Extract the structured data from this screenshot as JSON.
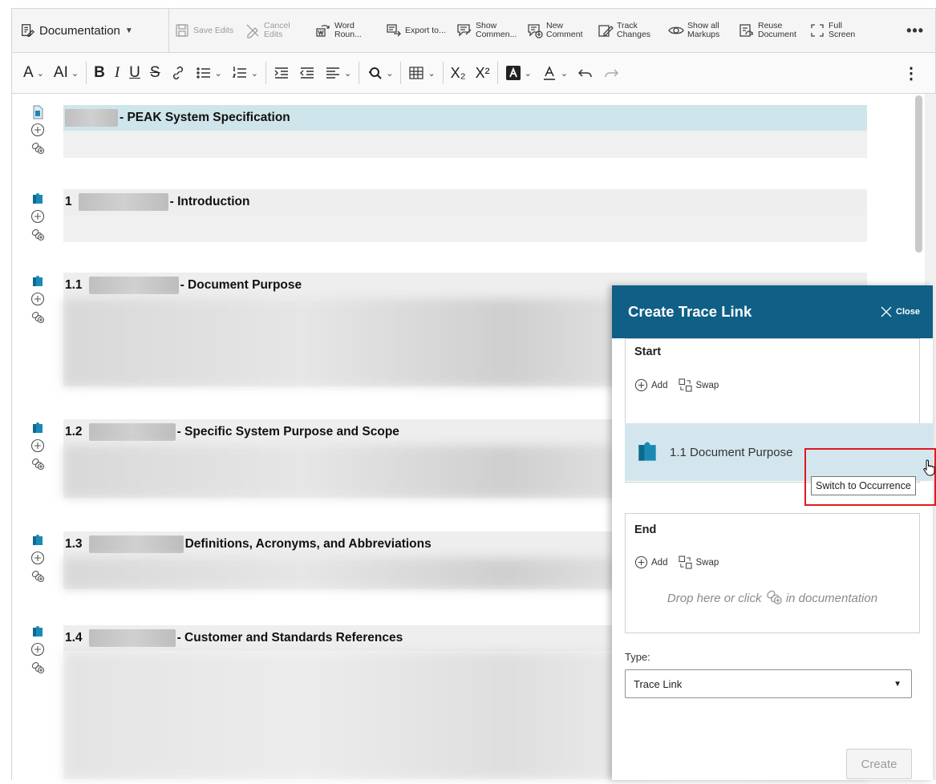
{
  "toolbar": {
    "documentation_label": "Documentation",
    "buttons": [
      {
        "label": "Save Edits",
        "icon": "save-icon",
        "disabled": true
      },
      {
        "label": "Cancel Edits",
        "icon": "cancel-edits-icon",
        "disabled": true
      },
      {
        "label": "Word Roun...",
        "icon": "word-roundtrip-icon",
        "disabled": false
      },
      {
        "label": "Export to...",
        "icon": "export-icon",
        "disabled": false
      },
      {
        "label": "Show Commen...",
        "icon": "show-comments-icon",
        "disabled": false
      },
      {
        "label": "New Comment",
        "icon": "new-comment-icon",
        "disabled": false
      },
      {
        "label": "Track Changes",
        "icon": "track-changes-icon",
        "disabled": false
      },
      {
        "label": "Show all Markups",
        "icon": "show-markups-icon",
        "disabled": false
      },
      {
        "label": "Reuse Document",
        "icon": "reuse-document-icon",
        "disabled": false
      },
      {
        "label": "Full Screen",
        "icon": "full-screen-icon",
        "disabled": false
      }
    ],
    "more_label": "•••"
  },
  "format_toolbar": {
    "text_style": "A",
    "font_size": "AI",
    "bold": "B",
    "italic": "I",
    "underline": "U",
    "strike": "S",
    "subscript": "X₂",
    "superscript": "X²",
    "kebab": "⋮"
  },
  "document": {
    "sections": [
      {
        "number": "",
        "title": "- PEAK System Specification"
      },
      {
        "number": "1",
        "title": "- Introduction"
      },
      {
        "number": "1.1",
        "title": "- Document Purpose"
      },
      {
        "number": "1.2",
        "title": "- Specific System Purpose and Scope"
      },
      {
        "number": "1.3",
        "title": "Definitions, Acronyms, and Abbreviations"
      },
      {
        "number": "1.4",
        "title": "- Customer and Standards References"
      }
    ]
  },
  "panel": {
    "title": "Create Trace Link",
    "close_label": "Close",
    "start_label": "Start",
    "end_label": "End",
    "add_label": "Add",
    "swap_label": "Swap",
    "start_item": "1.1 Document Purpose",
    "drop_hint_before": "Drop here or click",
    "drop_hint_after": "in documentation",
    "type_label": "Type:",
    "type_value": "Trace Link",
    "create_label": "Create"
  },
  "tooltip": "Switch to Occurrence",
  "colors": {
    "panel_header": "#0f5f86",
    "selected_item": "#d3e6ee",
    "heading_highlight": "#cfe5ec",
    "highlight_box": "#e0191f"
  }
}
